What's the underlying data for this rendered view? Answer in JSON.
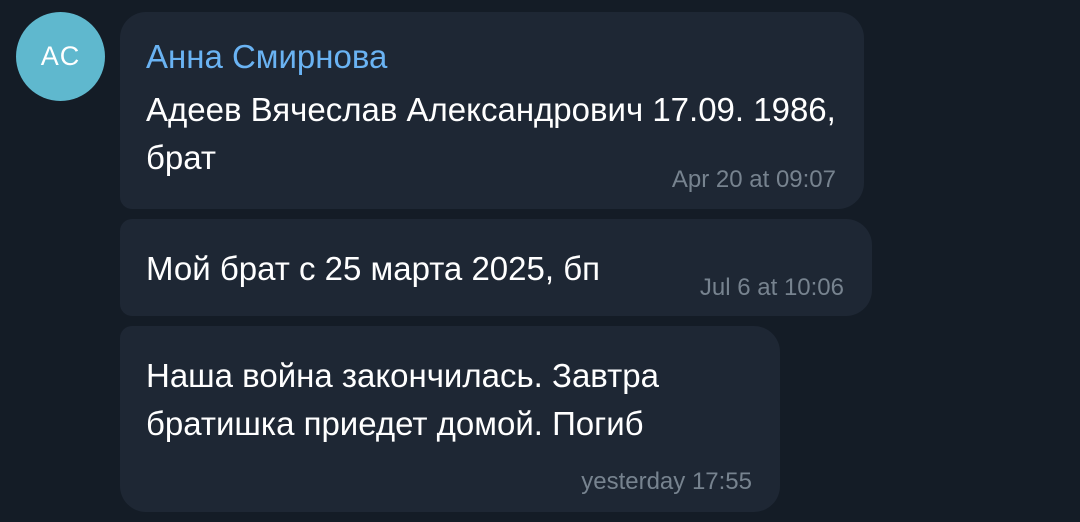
{
  "avatar": {
    "initials": "AC",
    "color": "#5fb8ce"
  },
  "messages": [
    {
      "sender": "Анна Смирнова",
      "text": "Адеев Вячеслав Александрович 17.09. 1986, брат",
      "time": "Apr 20 at 09:07"
    },
    {
      "text": "Мой брат с 25 марта 2025, бп",
      "time": "Jul 6 at 10:06"
    },
    {
      "text": "Наша война закончилась. Завтра братишка приедет домой. Погиб",
      "time": "yesterday 17:55"
    }
  ],
  "colors": {
    "background": "#141c26",
    "bubble": "#1e2734",
    "sender_name": "#6ab3f3",
    "timestamp": "#77838f"
  }
}
